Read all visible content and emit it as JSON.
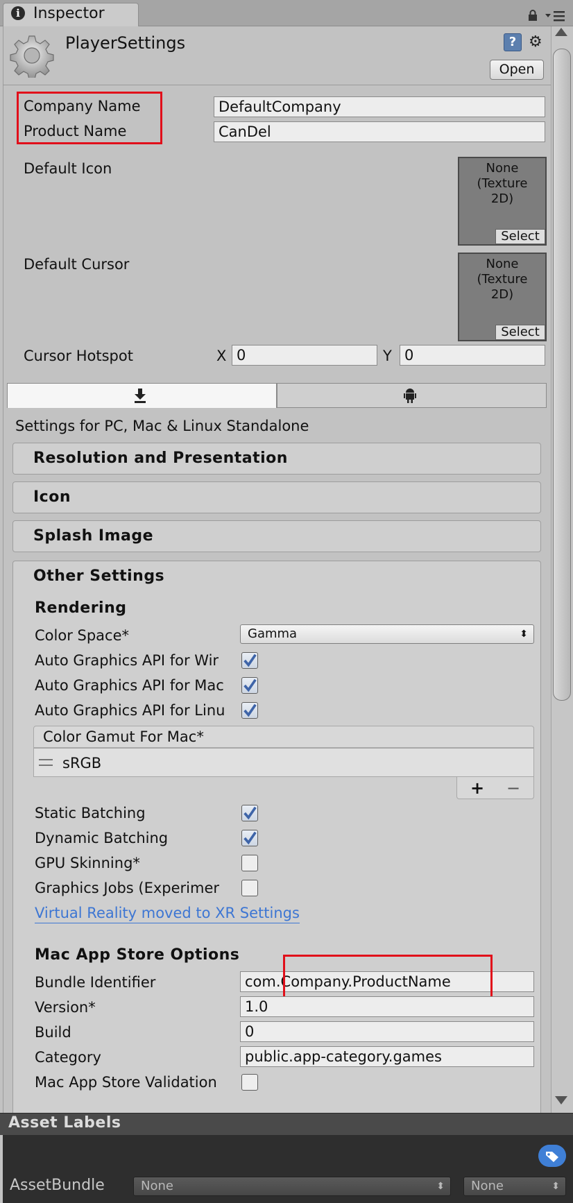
{
  "tab": {
    "title": "Inspector"
  },
  "header": {
    "title": "PlayerSettings",
    "help_symbol": "?",
    "settings_symbol": "⚙",
    "open_label": "Open"
  },
  "fields": {
    "company_name_label": "Company Name",
    "company_name_value": "DefaultCompany",
    "product_name_label": "Product Name",
    "product_name_value": "CanDel",
    "default_icon_label": "Default Icon",
    "default_cursor_label": "Default Cursor",
    "texture_none_line1": "None",
    "texture_none_line2": "(Texture",
    "texture_none_line3": "2D)",
    "select_label": "Select",
    "cursor_hotspot_label": "Cursor Hotspot",
    "x_label": "X",
    "x_value": "0",
    "y_label": "Y",
    "y_value": "0"
  },
  "platform": {
    "settings_for": "Settings for PC, Mac & Linux Standalone",
    "tab_standalone_icon": "download-icon",
    "tab_android_icon": "android-icon"
  },
  "sections": {
    "resolution": "Resolution and Presentation",
    "icon": "Icon",
    "splash": "Splash Image",
    "other": "Other Settings"
  },
  "rendering": {
    "heading": "Rendering",
    "color_space_label": "Color Space*",
    "color_space_value": "Gamma",
    "auto_graphics_win": "Auto Graphics API for Wir",
    "auto_graphics_mac": "Auto Graphics API for Mac",
    "auto_graphics_linux": "Auto Graphics API for Linu",
    "color_gamut_header": "Color Gamut For Mac*",
    "color_gamut_item": "sRGB",
    "list_add": "+",
    "list_remove": "−",
    "static_batching": "Static Batching",
    "dynamic_batching": "Dynamic Batching",
    "gpu_skinning": "GPU Skinning*",
    "graphics_jobs": "Graphics Jobs (Experimer",
    "vr_link": "Virtual Reality moved to XR Settings",
    "checks": {
      "auto_win": true,
      "auto_mac": true,
      "auto_linux": true,
      "static_batching": true,
      "dynamic_batching": true,
      "gpu_skinning": false,
      "graphics_jobs": false
    }
  },
  "mac_store": {
    "heading": "Mac App Store Options",
    "bundle_label": "Bundle Identifier",
    "bundle_value": "com.Company.ProductName",
    "version_label": "Version*",
    "version_value": "1.0",
    "build_label": "Build",
    "build_value": "0",
    "category_label": "Category",
    "category_value": "public.app-category.games",
    "validation_label": "Mac App Store Validation",
    "validation_checked": false
  },
  "asset_labels": {
    "title": "Asset Labels",
    "assetbundle_label": "AssetBundle",
    "bundle_dropdown": "None",
    "variant_dropdown": "None"
  },
  "colors": {
    "highlight": "#e10f1a",
    "link": "#3d76d3",
    "checkbox_tick": "#3e64a8"
  }
}
